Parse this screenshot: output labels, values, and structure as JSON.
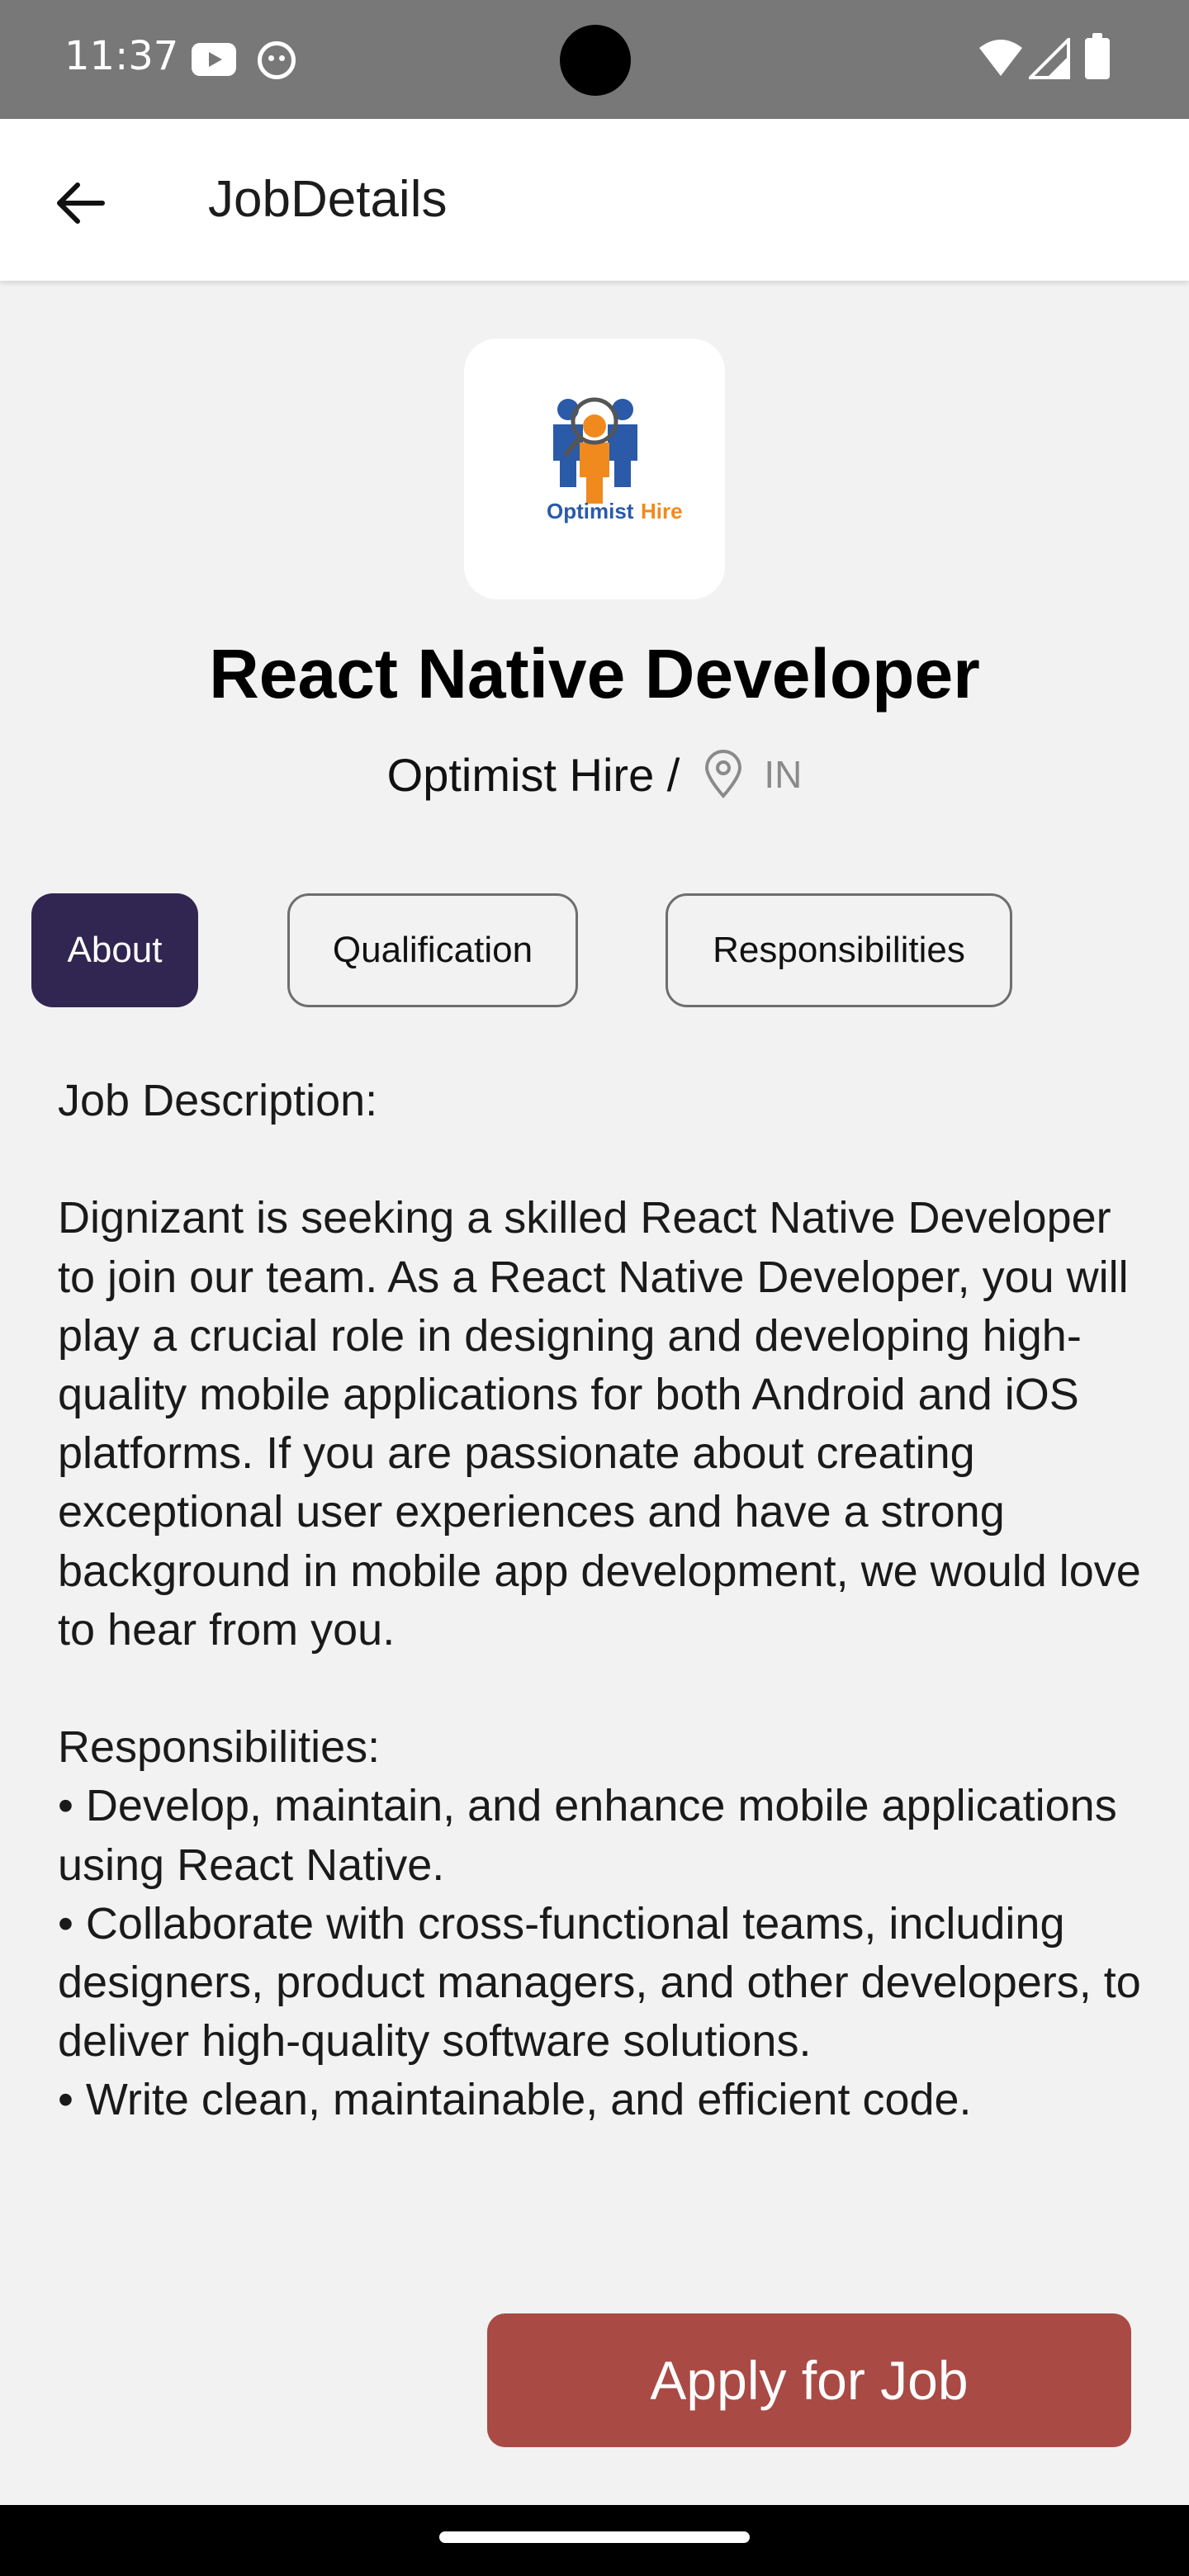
{
  "status_bar": {
    "time": "11:37"
  },
  "header": {
    "title": "JobDetails",
    "back_icon": "arrow-left-icon"
  },
  "job": {
    "logo_text_1": "Optimist",
    "logo_text_2": "Hire",
    "title": "React Native Developer",
    "company": "Optimist Hire /",
    "location": "IN"
  },
  "tabs": [
    {
      "label": "About",
      "active": true
    },
    {
      "label": "Qualification",
      "active": false
    },
    {
      "label": "Responsibilities",
      "active": false
    }
  ],
  "description": "Job Description:\n\nDignizant is seeking a skilled React Native Developer to join our team. As a React Native Developer, you will play a crucial role in designing and developing high-quality mobile applications for both Android and iOS platforms. If you are passionate about creating exceptional user experiences and have a strong background in mobile app development, we would love to hear from you.\n\nResponsibilities:\n• Develop, maintain, and enhance mobile applications using React Native.\n• Collaborate with cross-functional teams, including designers, product managers, and other developers, to deliver high-quality software solutions.\n• Write clean, maintainable, and efficient code.",
  "apply_button": {
    "label": "Apply for Job"
  },
  "colors": {
    "active_tab": "#312651",
    "apply_button": "#a94a45",
    "background": "#f2f2f2"
  }
}
